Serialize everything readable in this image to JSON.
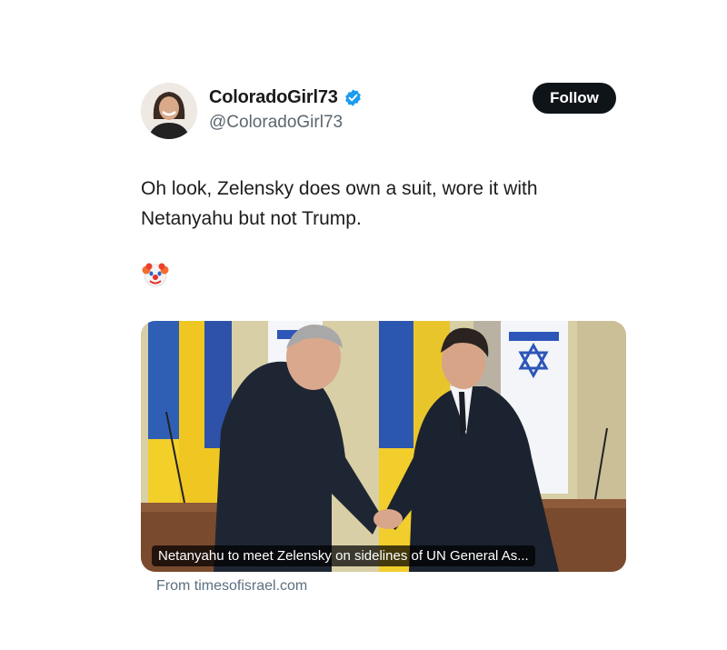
{
  "author": {
    "display_name": "ColoradoGirl73",
    "handle": "@ColoradoGirl73",
    "verified": true
  },
  "follow_label": "Follow",
  "tweet": {
    "text": "Oh look, Zelensky does own a suit, wore it with Netanyahu but not Trump.",
    "emoji": "clown-face"
  },
  "link_card": {
    "headline": "Netanyahu to meet Zelensky on sidelines of UN General As...",
    "source": "From timesofisrael.com"
  },
  "colors": {
    "verified_blue": "#1d9bf0",
    "follow_bg": "#0f1419",
    "handle_gray": "#5b6670"
  }
}
